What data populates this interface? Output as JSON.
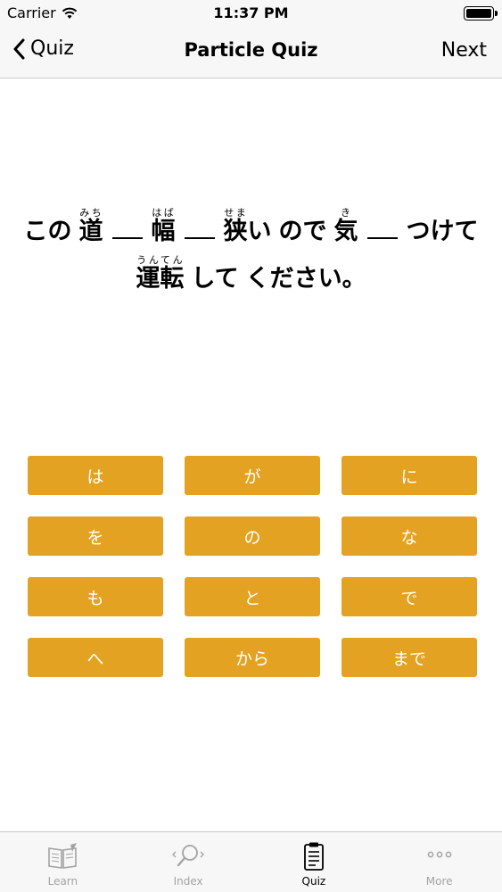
{
  "status_bar": {
    "carrier": "Carrier",
    "time": "11:37 PM"
  },
  "nav": {
    "back_label": "Quiz",
    "title": "Particle Quiz",
    "next_label": "Next"
  },
  "question": {
    "line1": {
      "w1": "この",
      "w2": {
        "base": "道",
        "ruby": "みち"
      },
      "w3": {
        "base": "幅",
        "ruby": "はば"
      },
      "w4": {
        "base": "狭",
        "ruby": "せま"
      },
      "w4_tail": "い",
      "w5": "ので",
      "w6": {
        "base": "気",
        "ruby": "き"
      },
      "w7": "つけて"
    },
    "line2": {
      "w1": {
        "base": "運転",
        "ruby": "うんてん"
      },
      "w2": "して",
      "w3": "ください。"
    }
  },
  "answers": [
    "は",
    "が",
    "に",
    "を",
    "の",
    "な",
    "も",
    "と",
    "で",
    "へ",
    "から",
    "まで"
  ],
  "tabs": [
    {
      "label": "Learn",
      "icon": "book-icon"
    },
    {
      "label": "Index",
      "icon": "search-icon"
    },
    {
      "label": "Quiz",
      "icon": "clipboard-icon",
      "active": true
    },
    {
      "label": "More",
      "icon": "more-icon"
    }
  ],
  "colors": {
    "accent": "#e3a221",
    "tab_inactive": "#a3a3a3",
    "bar_bg": "#f7f7f7"
  }
}
